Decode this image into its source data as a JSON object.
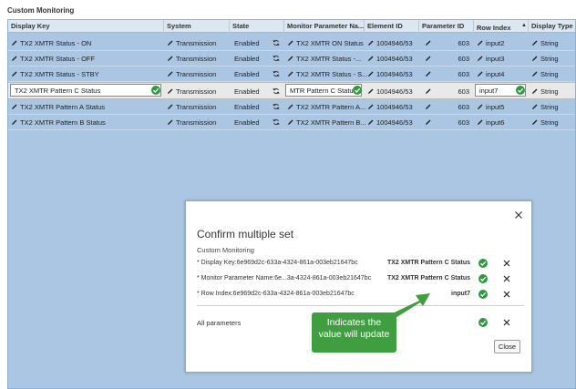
{
  "section_title": "Custom Monitoring",
  "columns": {
    "display_key": "Display Key",
    "system": "System",
    "state": "State",
    "monitor_param": "Monitor Parameter Na...",
    "element_id": "Element ID",
    "parameter_id": "Parameter ID",
    "row_index": "Row Index",
    "display_type": "Display Type",
    "sort_indicator": "▲"
  },
  "rows": [
    {
      "display_key": "TX2 XMTR Status - ON",
      "system": "Transmission",
      "state": "Enabled",
      "monitor_param": "TX2 XMTR ON Status",
      "element_id": "1004946/53",
      "parameter_id": "603",
      "row_index": "input2",
      "display_type": "String"
    },
    {
      "display_key": "TX2 XMTR Status - OFF",
      "system": "Transmission",
      "state": "Enabled",
      "monitor_param": "TX2 XMTR Status -...",
      "element_id": "1004946/53",
      "parameter_id": "603",
      "row_index": "input3",
      "display_type": "String"
    },
    {
      "display_key": "TX2 XMTR Status - STBY",
      "system": "Transmission",
      "state": "Enabled",
      "monitor_param": "TX2 XMTR Status - S...",
      "element_id": "1004946/53",
      "parameter_id": "603",
      "row_index": "input4",
      "display_type": "String"
    },
    {
      "display_key": "TX2 XMTR Pattern C Status",
      "system": "Transmission",
      "state": "Enabled",
      "monitor_param": "MTR Pattern C Status",
      "element_id": "1004946/53",
      "parameter_id": "603",
      "row_index": "input7",
      "display_type": "String"
    },
    {
      "display_key": "TX2 XMTR Pattern A Status",
      "system": "Transmission",
      "state": "Enabled",
      "monitor_param": "TX2 XMTR Pattern A...",
      "element_id": "1004946/53",
      "parameter_id": "603",
      "row_index": "input5",
      "display_type": "String"
    },
    {
      "display_key": "TX2 XMTR Pattern B Status",
      "system": "Transmission",
      "state": "Enabled",
      "monitor_param": "TX2 XMTR Pattern B...",
      "element_id": "1004946/53",
      "parameter_id": "603",
      "row_index": "input6",
      "display_type": "String"
    }
  ],
  "dialog": {
    "title": "Confirm multiple set",
    "section": "Custom Monitoring",
    "items": [
      {
        "label": "* Display Key:6e969d2c-633a-4324-861a-003eb21647bc",
        "value": "TX2 XMTR Pattern C Status"
      },
      {
        "label": "* Monitor Parameter Name:6e...3a-4324-861a-003eb21647bc",
        "value": "TX2 XMTR Pattern C Status"
      },
      {
        "label": "* Row Index:6e969d2c-633a-4324-861a-003eb21647bc",
        "value": "input7"
      }
    ],
    "all_parameters": "All parameters",
    "close_label": "Close"
  },
  "callout": {
    "line1": "Indicates the",
    "line2": "value will update"
  },
  "colors": {
    "grid_bg": "#aac6e3",
    "check_green": "#2e9a3f",
    "callout_green": "#3f9e3f"
  }
}
